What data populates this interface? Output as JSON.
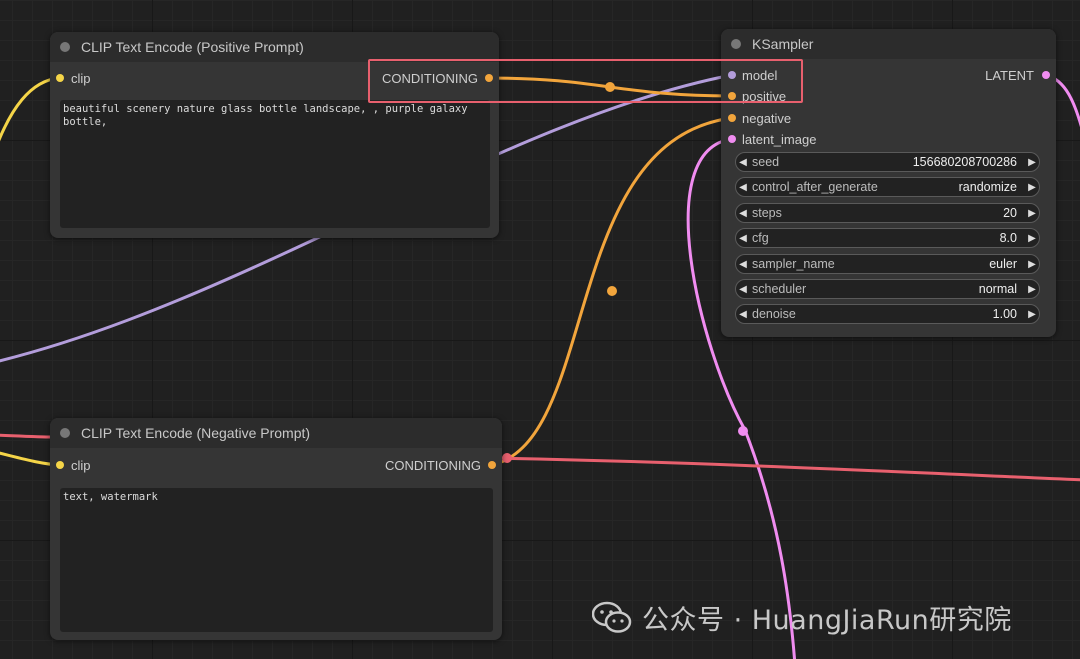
{
  "colors": {
    "clip": "#f5d548",
    "conditioning": "#f2a53c",
    "model": "#b39ddb",
    "latent": "#f08cf0",
    "red_link": "#e8606e",
    "highlight": "#e8606e"
  },
  "nodes": {
    "positive": {
      "title": "CLIP Text Encode (Positive Prompt)",
      "input_clip": "clip",
      "output": "CONDITIONING",
      "text": "beautiful scenery nature glass bottle landscape, , purple galaxy\nbottle,"
    },
    "negative": {
      "title": "CLIP Text Encode (Negative Prompt)",
      "input_clip": "clip",
      "output": "CONDITIONING",
      "text": "text, watermark"
    },
    "ksampler": {
      "title": "KSampler",
      "inputs": [
        "model",
        "positive",
        "negative",
        "latent_image"
      ],
      "output": "LATENT",
      "widgets": [
        {
          "label": "seed",
          "value": "156680208700286"
        },
        {
          "label": "control_after_generate",
          "value": "randomize"
        },
        {
          "label": "steps",
          "value": "20"
        },
        {
          "label": "cfg",
          "value": "8.0"
        },
        {
          "label": "sampler_name",
          "value": "euler"
        },
        {
          "label": "scheduler",
          "value": "normal"
        },
        {
          "label": "denoise",
          "value": "1.00"
        }
      ]
    }
  },
  "watermark": {
    "text": "公众号 · HuangJiaRun研究院",
    "icon": "wechat-icon"
  }
}
